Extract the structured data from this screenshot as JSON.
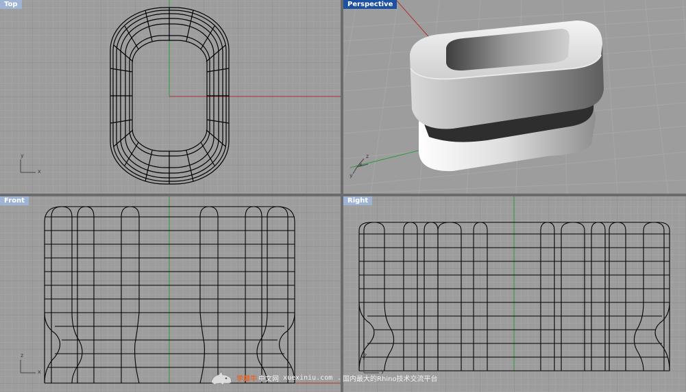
{
  "viewports": {
    "top": {
      "title": "Top",
      "axis_x": "x",
      "axis_y": "y"
    },
    "perspective": {
      "title": "Perspective",
      "axis_x": "x",
      "axis_y": "y",
      "axis_z": "z"
    },
    "front": {
      "title": "Front",
      "axis_x": "x",
      "axis_z": "z"
    },
    "right": {
      "title": "Right",
      "axis_y": "y",
      "axis_z": "z"
    }
  },
  "watermark": {
    "brand": "学犀牛",
    "cn_site": "中文网",
    "url": "xuexiniu.com",
    "tagline": "- 国内最大的Rhino技术交流平台"
  },
  "colors": {
    "viewport_bg": "#9d9d9d",
    "grid_minor": "#a9a9a9",
    "grid_major": "#8c8c8c",
    "axis_x": "#b0302f",
    "axis_y": "#2f9a3a",
    "active_title": "#1d4fa3",
    "inactive_title": "#9fb4d4"
  }
}
